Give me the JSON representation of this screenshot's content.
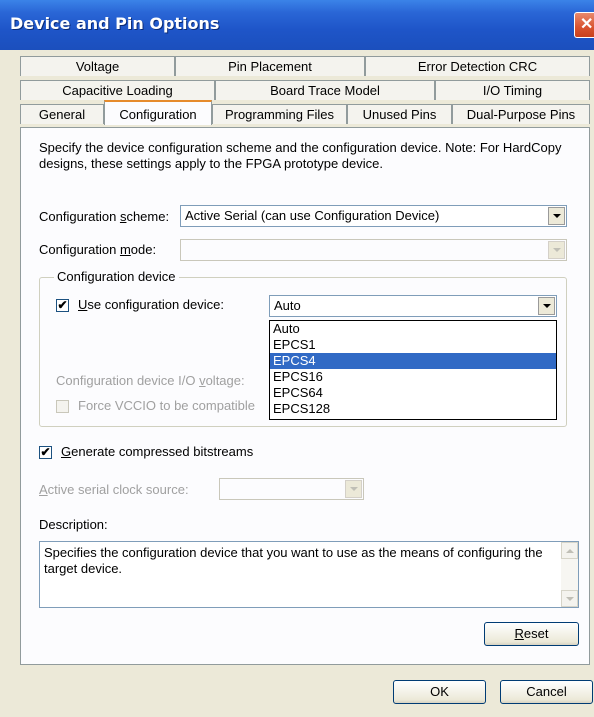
{
  "window": {
    "title": "Device and Pin Options",
    "close_glyph": "✕"
  },
  "tabs": {
    "row1": [
      "Voltage",
      "Pin Placement",
      "Error Detection CRC"
    ],
    "row2": [
      "Capacitive Loading",
      "Board Trace Model",
      "I/O Timing"
    ],
    "row3": [
      "General",
      "Configuration",
      "Programming Files",
      "Unused Pins",
      "Dual-Purpose Pins"
    ],
    "active": "Configuration"
  },
  "intro_text": "Specify the device configuration scheme and the configuration device. Note: For HardCopy designs, these settings apply to the FPGA prototype device.",
  "config_scheme": {
    "label_pre": "Configuration ",
    "label_accel": "s",
    "label_post": "cheme:",
    "value": "Active Serial (can use Configuration Device)"
  },
  "config_mode": {
    "label_pre": "Configuration ",
    "label_accel": "m",
    "label_post": "ode:",
    "value": ""
  },
  "config_device_group": {
    "title": "Configuration device",
    "use_device_checked": true,
    "use_device_accel": "U",
    "use_device_label": "se configuration device:",
    "device_value": "Auto",
    "device_options": [
      "Auto",
      "EPCS1",
      "EPCS4",
      "EPCS16",
      "EPCS64",
      "EPCS128"
    ],
    "selected_option": "EPCS4",
    "io_voltage_label_pre": "Configuration device I/O ",
    "io_voltage_label_accel": "v",
    "io_voltage_label_post": "oltage:",
    "force_vccio_label": "Force VCCIO to be compatible"
  },
  "compressed": {
    "checked": true,
    "accel": "G",
    "label": "enerate compressed bitstreams"
  },
  "clock_source": {
    "accel": "A",
    "label": "ctive serial clock source:",
    "value": ""
  },
  "description": {
    "label": "Description:",
    "text": "Specifies the configuration device that you want to use as the means of configuring the target device."
  },
  "buttons": {
    "reset_accel": "R",
    "reset": "eset",
    "ok": "OK",
    "cancel": "Cancel"
  },
  "check_glyph": "✔"
}
